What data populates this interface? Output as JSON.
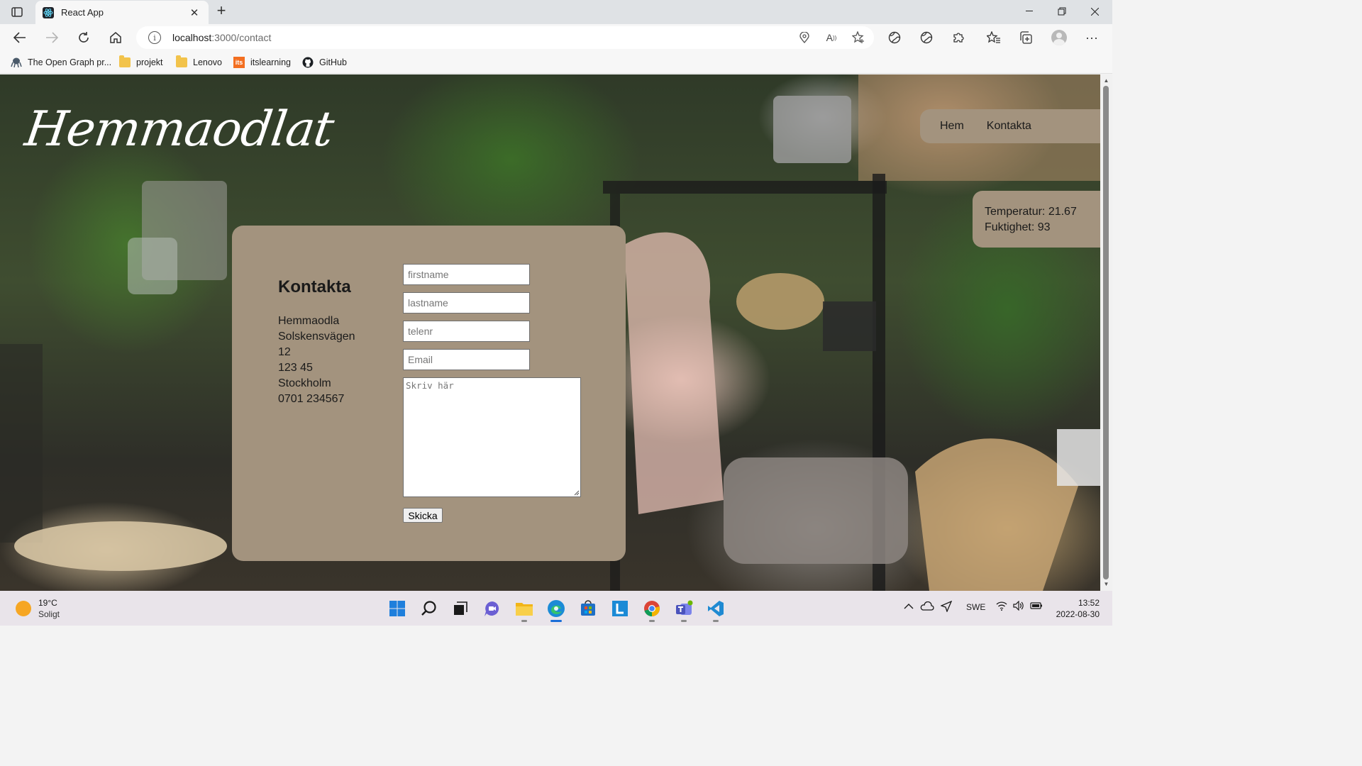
{
  "browser": {
    "tab_title": "React App",
    "url_host": "localhost",
    "url_path": ":3000/contact",
    "bookmarks": [
      {
        "label": "The Open Graph pr...",
        "icon": "octopus-icon"
      },
      {
        "label": "projekt",
        "icon": "folder-icon"
      },
      {
        "label": "Lenovo",
        "icon": "folder-icon"
      },
      {
        "label": "itslearning",
        "icon": "itslearning-icon",
        "icon_text": "its"
      },
      {
        "label": "GitHub",
        "icon": "github-icon"
      }
    ]
  },
  "site": {
    "brand": "Hemmaodlat",
    "nav": [
      {
        "label": "Hem"
      },
      {
        "label": "Kontakta"
      }
    ],
    "sensor": {
      "temperature": "Temperatur: 21.67",
      "humidity": "Fuktighet: 93"
    },
    "contact": {
      "title": "Kontakta",
      "address_lines": [
        "Hemmaodla",
        "Solskensvägen",
        "12",
        "123 45",
        "Stockholm",
        "0701 234567"
      ],
      "fields": {
        "firstname_placeholder": "firstname",
        "lastname_placeholder": "lastname",
        "phone_placeholder": "telenr",
        "email_placeholder": "Email",
        "message_placeholder": "Skriv här"
      },
      "submit_label": "Skicka"
    }
  },
  "taskbar": {
    "weather_temp": "19°C",
    "weather_desc": "Soligt",
    "language": "SWE",
    "time": "13:52",
    "date": "2022-08-30"
  },
  "colors": {
    "panel": "#a3937e",
    "accent": "#1a6ed8"
  }
}
